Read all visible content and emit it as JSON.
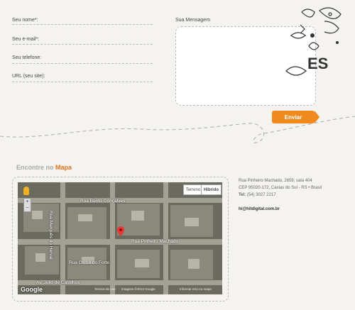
{
  "form": {
    "name_label": "Seu nome*:",
    "email_label": "Seu e-mail*:",
    "phone_label": "Seu telefone:",
    "url_label": "URL (seu site):",
    "message_label": "Sua Mensagem",
    "send_label": "Enviar"
  },
  "map_section": {
    "title_prefix": "Encontre no",
    "title_highlight": "Mapa",
    "btn_terrain": "Terreno",
    "btn_hybrid": "Hibrido",
    "street_1": "Rua Bento Gonçalves",
    "street_2": "Rua Pinheiro Machado",
    "street_3": "Av. Júlio de Castilhos",
    "street_4": "Rua Marquês do Herval",
    "street_5": "Rua Os 18 do Forte",
    "google_logo": "Google",
    "footer_1": "Termos de uso",
    "footer_2": "Imagens ©2013 Google",
    "footer_3": "Informar erro no mapa"
  },
  "contact": {
    "address_line1": "Rua Pinheiro Machado, 2659, sala 404",
    "address_line2": "CEP 95020-172, Caxias do Sul - RS • Brasil",
    "phone_label": "Tel:",
    "phone_value": "(54) 3027 2217",
    "email": "hi@hitdigital.com.br"
  },
  "colors": {
    "accent": "#f08a1e",
    "background": "#f4f3ef"
  }
}
